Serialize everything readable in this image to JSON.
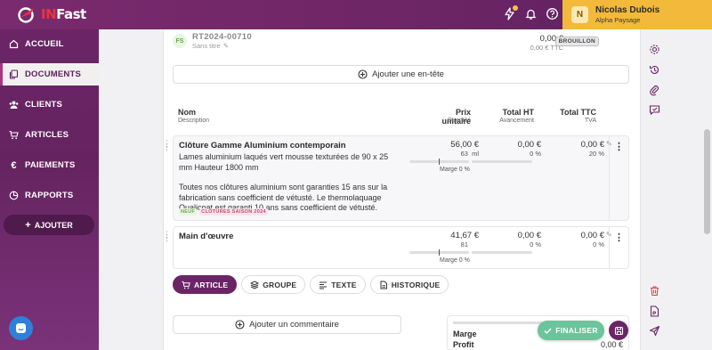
{
  "app": {
    "brand_prefix": "IN",
    "brand_suffix": "Fast"
  },
  "user": {
    "initial": "N",
    "name": "Nicolas Dubois",
    "company": "Alpha Paysage"
  },
  "topbar_icons": [
    "lightning-icon",
    "bell-icon",
    "help-icon"
  ],
  "sidebar": {
    "items": [
      {
        "label": "ACCUEIL",
        "icon": "home-icon",
        "active": false
      },
      {
        "label": "DOCUMENTS",
        "icon": "documents-icon",
        "active": true
      },
      {
        "label": "CLIENTS",
        "icon": "clients-icon",
        "active": false
      },
      {
        "label": "ARTICLES",
        "icon": "cart-icon",
        "active": false
      },
      {
        "label": "PAIEMENTS",
        "icon": "euro-icon",
        "active": false
      },
      {
        "label": "RAPPORTS",
        "icon": "reports-icon",
        "active": false
      }
    ],
    "add_label": "AJOUTER"
  },
  "document": {
    "badge": "FS",
    "reference": "RT2024-00710",
    "subtitle": "Sans titre",
    "total_ht": "0,00 €",
    "total_ttc": "0,00 € TTC",
    "status": "BROUILLON",
    "add_header_label": "Ajouter une en-tête"
  },
  "columns": {
    "name": "Nom",
    "name_sub": "Description",
    "unit_price": "Prix unitaire",
    "unit_price_sub": "Quantité",
    "total_ht": "Total HT",
    "total_ht_sub": "Avancement",
    "total_ttc": "Total TTC",
    "total_ttc_sub": "TVA"
  },
  "lines": [
    {
      "title": "Clôture Gamme Aluminium contemporain",
      "description_1": "Lames aluminium laqués vert mousse texturées de 90 x 25 mm Hauteur 1800 mm",
      "description_2": "Toutes nos clôtures aluminium sont garanties 15 ans sur la fabrication sans coefficient de vétusté. Le thermolaquage Qualicoat est garanti 10 ans sans coefficient de vétusté.",
      "tag_new": "NEUF",
      "tag_category": "CLÔTURES SAISON 2024",
      "unit_price": "56,00 €",
      "quantity": "63",
      "unit": "ml",
      "total_ht": "0,00 €",
      "progress": "0 %",
      "total_ttc": "0,00 €",
      "vat": "20 %",
      "margin": "Marge 0 %",
      "margin_fraction": 0.0
    },
    {
      "title": "Main d'œuvre",
      "unit_price": "41,67 €",
      "quantity": "81",
      "total_ht": "0,00 €",
      "progress": "0 %",
      "total_ttc": "0,00 €",
      "vat": "0 %",
      "margin": "Marge 0 %",
      "margin_fraction": 0.0
    }
  ],
  "actions": {
    "article": "ARTICLE",
    "group": "GROUPE",
    "text": "TEXTE",
    "history": "HISTORIQUE"
  },
  "comment": {
    "add_label": "Ajouter un commentaire"
  },
  "summary": {
    "margin_label": "Marge",
    "profit_label": "Profit",
    "profit_value": "0,00 €"
  },
  "finalize_label": "FINALISER",
  "right_rail_icons": [
    "settings-icon",
    "history-icon",
    "attachment-icon",
    "comment-icon",
    "delete-icon",
    "pdf-icon",
    "send-icon"
  ]
}
